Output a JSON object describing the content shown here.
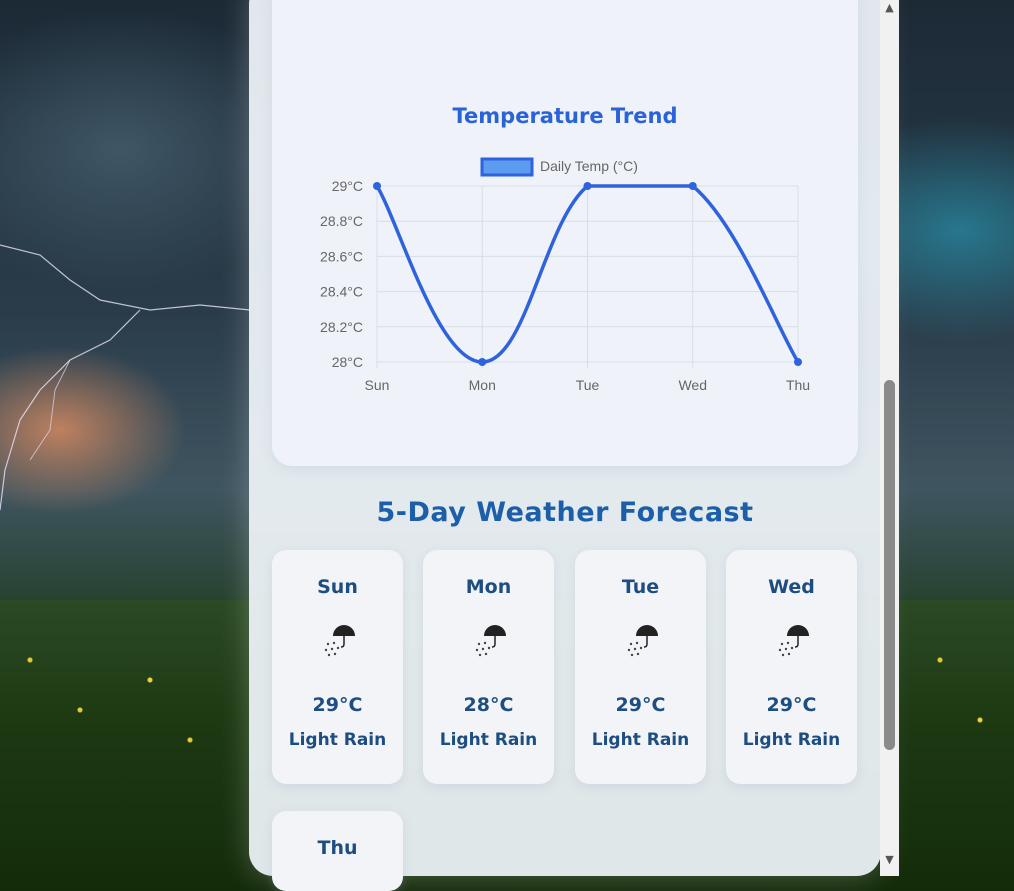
{
  "chart_card": {
    "title": "Temperature Trend"
  },
  "chart_data": {
    "type": "line",
    "title": "Temperature Trend",
    "categories": [
      "Sun",
      "Mon",
      "Tue",
      "Wed",
      "Thu"
    ],
    "series": [
      {
        "name": "Daily Temp (°C)",
        "values": [
          29,
          28,
          29,
          29,
          28
        ],
        "color": "#2f62dd"
      }
    ],
    "ylim": [
      28,
      29
    ],
    "yticks": [
      "28°C",
      "28.2°C",
      "28.4°C",
      "28.6°C",
      "28.8°C",
      "29°C"
    ],
    "grid": true,
    "legend": "top",
    "legend_swatch_color": "#5b9bf0"
  },
  "forecast": {
    "title": "5-Day Weather Forecast",
    "days": [
      {
        "name": "Sun",
        "icon": "light-rain-icon",
        "temp": "29°C",
        "desc": "Light Rain"
      },
      {
        "name": "Mon",
        "icon": "light-rain-icon",
        "temp": "28°C",
        "desc": "Light Rain"
      },
      {
        "name": "Tue",
        "icon": "light-rain-icon",
        "temp": "29°C",
        "desc": "Light Rain"
      },
      {
        "name": "Wed",
        "icon": "light-rain-icon",
        "temp": "29°C",
        "desc": "Light Rain"
      },
      {
        "name": "Thu",
        "icon": "",
        "temp": "",
        "desc": ""
      }
    ]
  },
  "colors": {
    "accent": "#2a62d8",
    "heading": "#1c5fa8",
    "card_text": "#1e4d80"
  }
}
